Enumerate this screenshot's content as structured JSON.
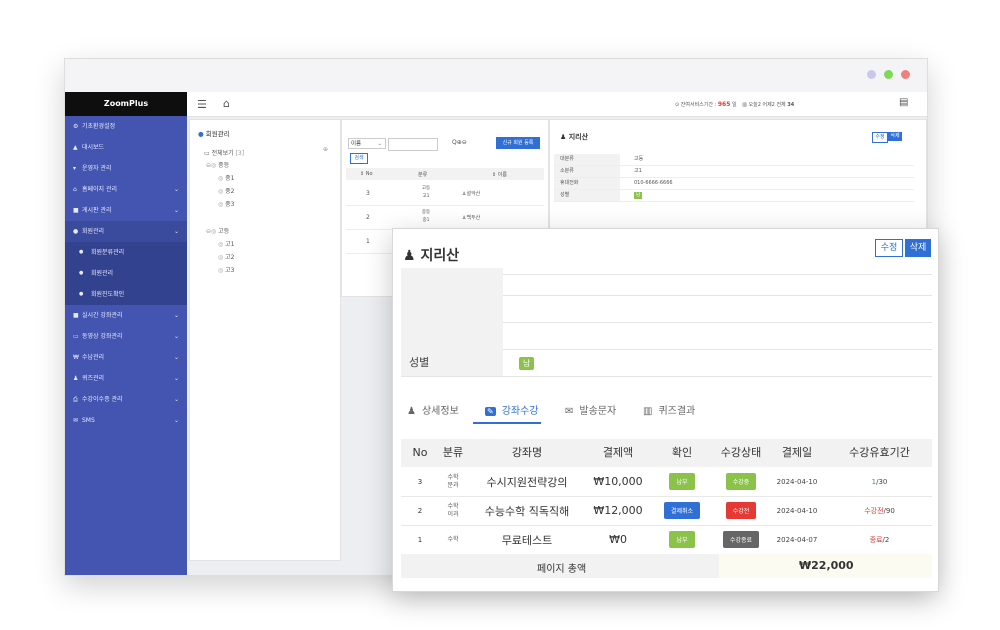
{
  "colors": {
    "sidebar": "#4455b1",
    "sidebar_sub": "#33428f",
    "logo_bg": "#0e0e0e",
    "accent_blue": "#2f6fd6",
    "green": "#8bc34a",
    "red": "#e53935",
    "gray_badge": "#666666",
    "dot1": "#c9c8ec",
    "dot2": "#7ed957",
    "dot3": "#f08080"
  },
  "app": {
    "logo": "ZoomPlus"
  },
  "topbar": {
    "remaining_label": "잔여서비스기간 :",
    "remaining_days": "965",
    "remaining_unit": "일",
    "visitors": "오늘2 어제2 전체",
    "visitors_total": "34"
  },
  "sidebar": {
    "items": [
      {
        "icon": "⚙",
        "icon_name": "gear-icon",
        "label": "기초환경설정",
        "chevron": false
      },
      {
        "icon": "▲",
        "icon_name": "dashboard-icon",
        "label": "대시보드",
        "chevron": false
      },
      {
        "icon": "▾",
        "icon_name": "user-icon",
        "label": "운영자 관리",
        "chevron": false
      },
      {
        "icon": "⌂",
        "icon_name": "home-icon",
        "label": "홈페이지 관리",
        "chevron": true
      },
      {
        "icon": "■",
        "icon_name": "board-icon",
        "label": "게시판 관리",
        "chevron": true
      },
      {
        "icon": "●",
        "icon_name": "members-icon",
        "label": "회원관리",
        "chevron": true,
        "active": true
      },
      {
        "icon": "●",
        "icon_name": "bullet-icon",
        "label": "회원분류관리",
        "sub": true
      },
      {
        "icon": "●",
        "icon_name": "bullet-icon",
        "label": "회원관리",
        "sub": true
      },
      {
        "icon": "●",
        "icon_name": "bullet-icon",
        "label": "회원진도확인",
        "sub": true
      },
      {
        "icon": "■",
        "icon_name": "video-icon",
        "label": "실시간 강좌관리",
        "chevron": true
      },
      {
        "icon": "▭",
        "icon_name": "monitor-icon",
        "label": "동영상 강좌관리",
        "chevron": true
      },
      {
        "icon": "₩",
        "icon_name": "won-icon",
        "label": "수납관리",
        "chevron": true
      },
      {
        "icon": "♟",
        "icon_name": "quiz-icon",
        "label": "퀴즈관리",
        "chevron": true
      },
      {
        "icon": "⎙",
        "icon_name": "certificate-icon",
        "label": "수강이수증 관리",
        "chevron": true
      },
      {
        "icon": "✉",
        "icon_name": "mail-icon",
        "label": "SMS",
        "chevron": true
      }
    ]
  },
  "tree": {
    "title": "회원관리",
    "all": "전체보기",
    "all_count": "[3]",
    "groups": [
      {
        "label": "중등",
        "children": [
          "중1",
          "중2",
          "중3"
        ]
      },
      {
        "label": "고등",
        "children": [
          "고1",
          "고2",
          "고3"
        ]
      }
    ]
  },
  "list": {
    "select_value": "이름",
    "search_button": "검색",
    "new_member_button": "신규 회원 등록",
    "headers": [
      "No",
      "분류",
      "이름"
    ],
    "rows": [
      {
        "no": "3",
        "cat1": "고등",
        "cat2": "고1",
        "name": "설악산"
      },
      {
        "no": "2",
        "cat1": "중등",
        "cat2": "중1",
        "name": "백두산"
      },
      {
        "no": "1",
        "cat1": "",
        "cat2": "",
        "name": ""
      }
    ]
  },
  "detail_bg": {
    "name": "지리산",
    "edit": "수정",
    "delete": "삭제",
    "rows": [
      {
        "k": "대분류",
        "v": "고등"
      },
      {
        "k": "소분류",
        "v": "고1"
      },
      {
        "k": "휴대전화",
        "v": "010-6666-6666"
      },
      {
        "k": "성별",
        "v": "남"
      }
    ]
  },
  "detail": {
    "name": "지리산",
    "edit": "수정",
    "delete": "삭제",
    "rows": [
      {
        "no": "3",
        "cat1": "수학",
        "cat2": "문과",
        "course": "수시지원전략강의",
        "amount": "₩10,000",
        "confirm": "납부",
        "confirm_color": "#8bc34a",
        "status": "수강중",
        "status_color": "#8bc34a",
        "date": "2024-04-10",
        "valid_a": "1",
        "valid_b": "/30",
        "valid_color": "#43a047"
      },
      {
        "no": "2",
        "cat1": "수학",
        "cat2": "이과",
        "course": "수능수학 직독직해",
        "amount": "₩12,000",
        "confirm": "결제취소",
        "confirm_color": "#2f6fd6",
        "status": "수강전",
        "status_color": "#e53935",
        "date": "2024-04-10",
        "valid_a": "수강전",
        "valid_b": "/90",
        "valid_color": "#e53935"
      },
      {
        "no": "1",
        "cat1": "수학",
        "cat2": "",
        "course": "무료테스트",
        "amount": "₩0",
        "confirm": "납부",
        "confirm_color": "#8bc34a",
        "status": "수강종료",
        "status_color": "#666666",
        "date": "2024-04-07",
        "valid_a": "종료",
        "valid_b": "/2",
        "valid_color": "#e53935"
      }
    ],
    "gender_label": "성별",
    "gender_value": "남",
    "tabs": [
      {
        "label": "상세정보",
        "icon_name": "user-icon",
        "active": false
      },
      {
        "label": "강좌수강",
        "icon_name": "edit-icon",
        "active": true
      },
      {
        "label": "발송문자",
        "icon_name": "mail-icon",
        "active": false
      },
      {
        "label": "퀴즈결과",
        "icon_name": "chart-icon",
        "active": false
      }
    ],
    "columns": [
      "No",
      "분류",
      "강좌명",
      "결제액",
      "확인",
      "수강상태",
      "결제일",
      "수강유효기간"
    ],
    "total_label": "페이지 총액",
    "total_value": "₩22,000"
  }
}
